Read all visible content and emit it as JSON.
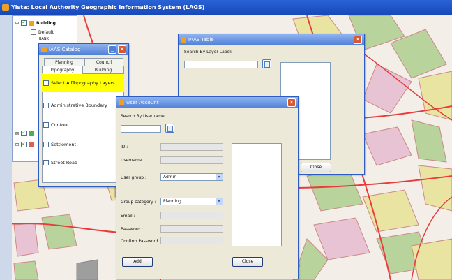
{
  "app": {
    "title": "Yista: Local Authority Geographic Information System (LAGS)"
  },
  "layers": {
    "group": "Building",
    "items": [
      "Default",
      "BANK"
    ]
  },
  "catalog": {
    "title": "IAAS Catalog",
    "tabs_row1": [
      "Planning",
      "Council"
    ],
    "tabs_row2": [
      "Topography",
      "Building"
    ],
    "items": [
      "Select AllTopography Layers",
      "Administrative Boundary",
      "Contour",
      "Settlement",
      "Street Road"
    ]
  },
  "table": {
    "title": "IAAS Table",
    "search_label": "Search By Layer Label:",
    "close_label": "Close"
  },
  "account": {
    "title": "User Account",
    "search_label": "Search By Username:",
    "fields": {
      "id_label": "ID :",
      "name_label": "Username :",
      "group_label": "User group :",
      "group_value": "Admin",
      "category_label": "Group category :",
      "category_value": "Planning",
      "email_label": "Email :",
      "password_label": "Password :",
      "confirm_label": "Confirm Password :"
    },
    "add_label": "Add",
    "close_label": "Close"
  },
  "colors": {
    "title_bar": "#1747b8",
    "highlight": "#ffff00",
    "map_green": "#b9d39c",
    "map_yellow": "#e9e4a2",
    "map_pink": "#e7c3d3",
    "road": "#e83c3c"
  }
}
